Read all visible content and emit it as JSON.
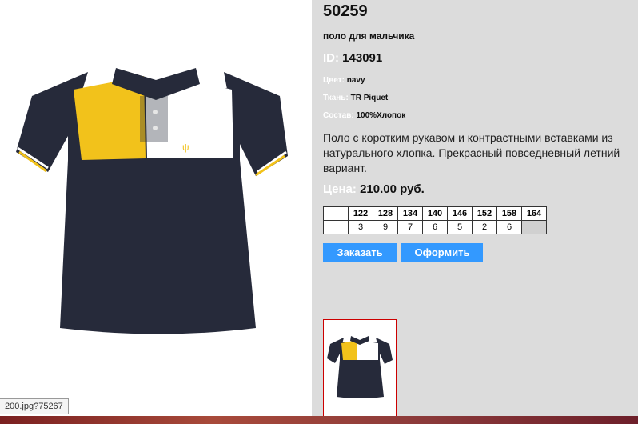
{
  "product": {
    "article": "50259",
    "subtitle": "поло для мальчика",
    "id_label": "ID:",
    "id_value": "143091",
    "specs": [
      {
        "label": "Цвет:",
        "value": "navy"
      },
      {
        "label": "Ткань:",
        "value": "TR Piquet"
      },
      {
        "label": "Состав:",
        "value": "100%Хлопок"
      }
    ],
    "description": "Поло с коротким рукавом и контрастными вставками из натурального хлопка. Прекрасный повседневный летний вариант.",
    "price_label": "Цена:",
    "price_value": "210.00 руб."
  },
  "sizes": {
    "header": [
      "122",
      "128",
      "134",
      "140",
      "146",
      "152",
      "158",
      "164"
    ],
    "quantities": [
      "3",
      "9",
      "7",
      "6",
      "5",
      "2",
      "6",
      ""
    ]
  },
  "buttons": {
    "order": "Заказать",
    "checkout": "Оформить"
  },
  "status_bar": {
    "url": "200.jpg?75267"
  },
  "colors": {
    "navy": "#262a3a",
    "yellow": "#f2c21b",
    "button": "#3399ff",
    "thumb_border": "#cc0000"
  }
}
